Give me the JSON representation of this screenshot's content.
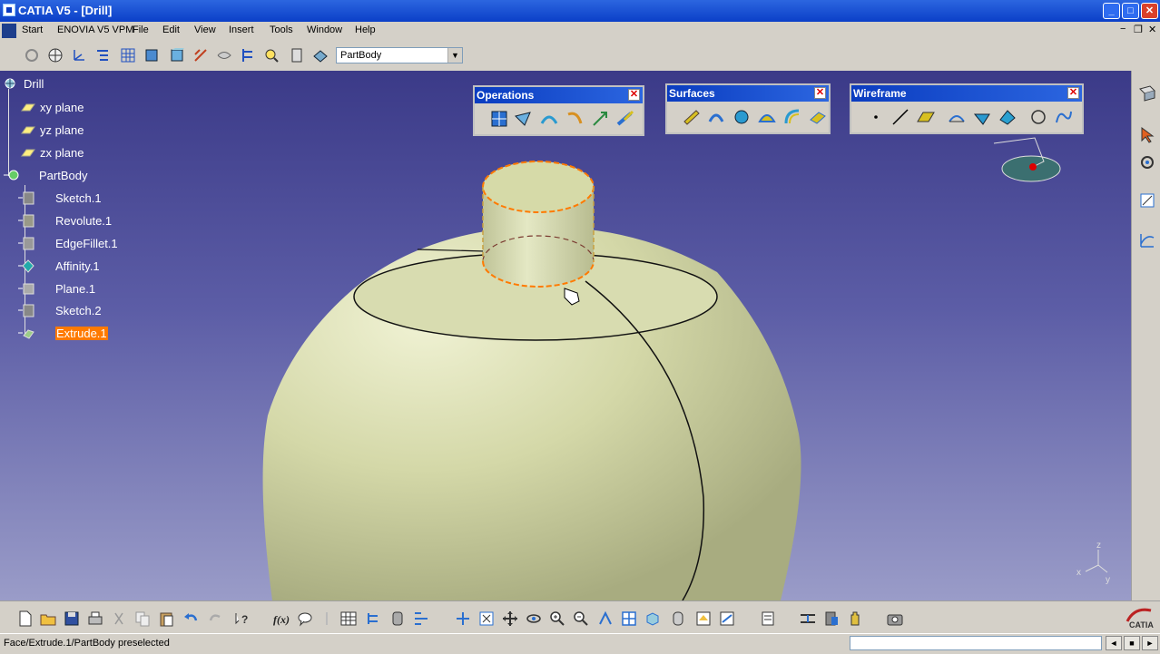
{
  "window": {
    "title": "CATIA V5 - [Drill]",
    "min": "_",
    "max": "□",
    "close": "✕"
  },
  "menu": {
    "items": [
      "Start",
      "ENOVIA V5 VPM",
      "File",
      "Edit",
      "View",
      "Insert",
      "Tools",
      "Window",
      "Help"
    ],
    "mdi_min": "−",
    "mdi_restore": "❐",
    "mdi_close": "✕"
  },
  "toolbar": {
    "workbench_combo": "PartBody",
    "combo_arrow": "▼"
  },
  "tree": {
    "root": "Drill",
    "nodes": [
      "xy plane",
      "yz plane",
      "zx plane",
      "PartBody",
      "Sketch.1",
      "Revolute.1",
      "EdgeFillet.1",
      "Affinity.1",
      "Plane.1",
      "Sketch.2",
      "Extrude.1"
    ],
    "selected": "Extrude.1"
  },
  "panels": {
    "operations": {
      "title": "Operations",
      "close": "✕"
    },
    "surfaces": {
      "title": "Surfaces",
      "close": "✕"
    },
    "wireframe": {
      "title": "Wireframe",
      "close": "✕"
    }
  },
  "compass": {
    "x": "x",
    "y": "y",
    "z": "z"
  },
  "status": {
    "message": "Face/Extrude.1/PartBody preselected"
  },
  "colors": {
    "viewport_top": "#3b3a88",
    "model": "#d4d8a8",
    "selection": "#ff7a00",
    "title": "#0a3cc0"
  }
}
